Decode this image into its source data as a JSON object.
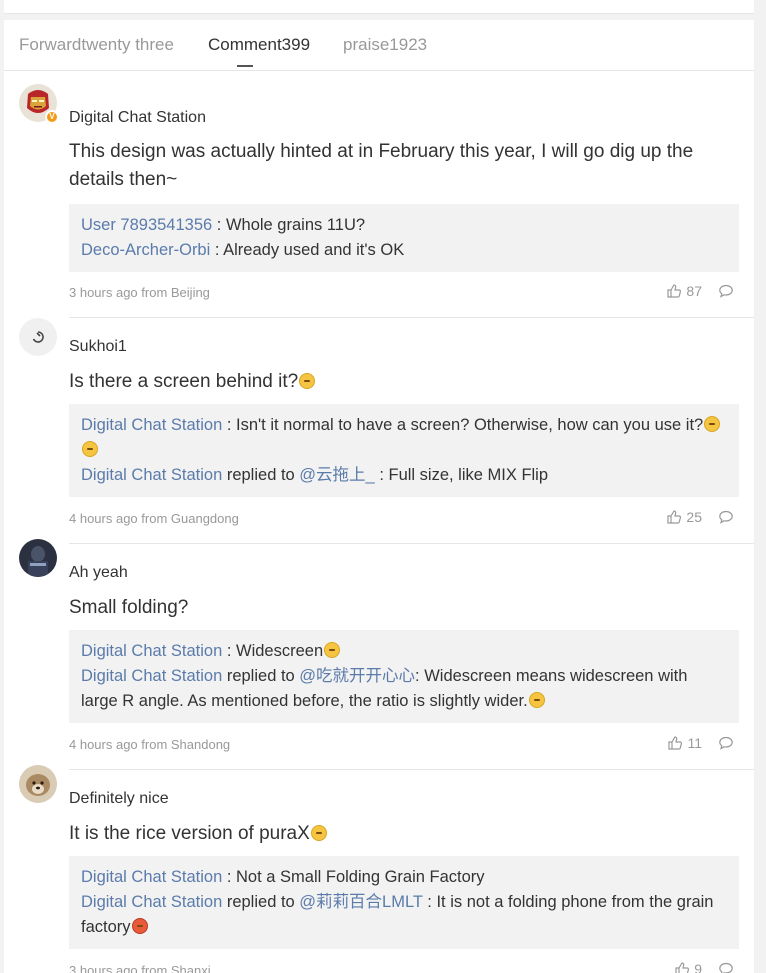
{
  "tabs": [
    {
      "label": "Forwardtwenty three"
    },
    {
      "label": "Comment399"
    },
    {
      "label": "praise1923"
    }
  ],
  "comments": [
    {
      "name": "Digital Chat Station",
      "avatar_icon": "iron-man-avatar",
      "verified_badge": "V",
      "text": "This design was actually hinted at in February this year, I will go dig up the details then~",
      "replies": [
        {
          "user": "User 7893541356",
          "sep": " : ",
          "text": "Whole grains 11U?"
        },
        {
          "user": "Deco-Archer-Orbi",
          "sep": " : ",
          "text": "Already used and it's OK"
        }
      ],
      "meta": "3 hours ago from Beijing",
      "likes": "87"
    },
    {
      "name": "Sukhoi1",
      "avatar_icon": "default-avatar",
      "text": "Is there a screen behind it?",
      "replies": [
        {
          "user": "Digital Chat Station",
          "sep": " : ",
          "text": "Isn't it normal to have a screen? Otherwise, how can you use it?"
        },
        {
          "user": "Digital Chat Station",
          "replied_to": " replied to ",
          "mention": "@云拖上_",
          "sep": " : ",
          "text": "Full size, like MIX Flip"
        }
      ],
      "meta": "4 hours ago from Guangdong",
      "likes": "25"
    },
    {
      "name": "Ah yeah",
      "avatar_icon": "dark-photo-avatar",
      "text": "Small folding?",
      "replies": [
        {
          "user": "Digital Chat Station",
          "sep": " : ",
          "text": "Widescreen"
        },
        {
          "user": "Digital Chat Station",
          "replied_to": " replied to ",
          "mention": "@吃就开开心心",
          "sep": ": ",
          "text": "Widescreen means widescreen with large R angle. As mentioned before, the ratio is slightly wider."
        }
      ],
      "meta": "4 hours ago from Shandong",
      "likes": "11"
    },
    {
      "name": "Definitely nice",
      "avatar_icon": "dog-photo-avatar",
      "text": "It is the rice version of puraX",
      "replies": [
        {
          "user": "Digital Chat Station",
          "sep": " : ",
          "text": "Not a Small Folding Grain Factory"
        },
        {
          "user": "Digital Chat Station",
          "replied_to": " replied to ",
          "mention": "@莉莉百合LMLT",
          "sep": " : ",
          "text": "It is not a folding phone from the grain factory"
        }
      ],
      "meta": "3 hours ago from Shanxi",
      "likes": "9"
    }
  ],
  "colors": {
    "link": "#5b7bab",
    "reply_bg": "#f2f2f2",
    "meta": "#999999"
  }
}
